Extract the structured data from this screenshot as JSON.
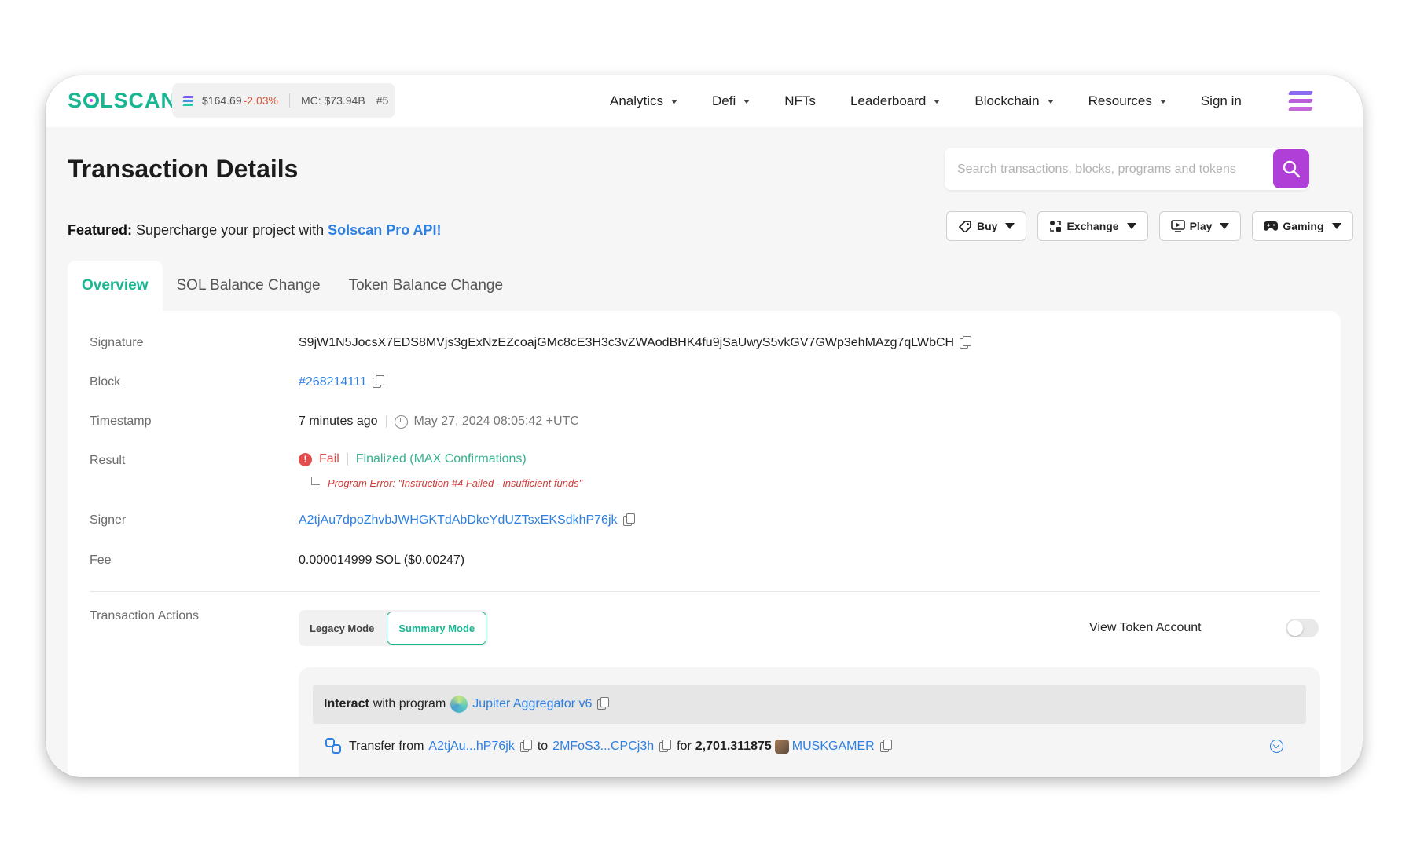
{
  "header": {
    "logo_text": "SOLSCAN",
    "sol_price": "$164.69",
    "sol_change": "-2.03%",
    "market_cap": "MC: $73.94B",
    "rank": "#5",
    "nav": [
      {
        "label": "Analytics"
      },
      {
        "label": "Defi"
      },
      {
        "label": "NFTs"
      },
      {
        "label": "Leaderboard"
      },
      {
        "label": "Blockchain"
      },
      {
        "label": "Resources"
      },
      {
        "label": "Sign in"
      }
    ]
  },
  "page": {
    "title": "Transaction Details",
    "search_placeholder": "Search transactions, blocks, programs and tokens"
  },
  "featured": {
    "prefix": "Featured:",
    "text": "Supercharge your project with",
    "link": "Solscan Pro API!"
  },
  "action_buttons": [
    {
      "label": "Buy"
    },
    {
      "label": "Exchange"
    },
    {
      "label": "Play"
    },
    {
      "label": "Gaming"
    }
  ],
  "tabs": [
    {
      "label": "Overview",
      "active": true
    },
    {
      "label": "SOL Balance Change"
    },
    {
      "label": "Token Balance Change"
    }
  ],
  "details": {
    "signature_label": "Signature",
    "signature": "S9jW1N5JocsX7EDS8MVjs3gExNzEZcoajGMc8cE3H3c3vZWAodBHK4fu9jSaUwyS5vkGV7GWp3ehMAzg7qLWbCH",
    "block_label": "Block",
    "block": "#268214111",
    "timestamp_label": "Timestamp",
    "timestamp_relative": "7 minutes ago",
    "timestamp_abs": "May 27, 2024 08:05:42 +UTC",
    "result_label": "Result",
    "result_status": "Fail",
    "result_finality": "Finalized (MAX Confirmations)",
    "program_error": "Program Error: \"Instruction #4 Failed - insufficient funds\"",
    "signer_label": "Signer",
    "signer": "A2tjAu7dpoZhvbJWHGKTdAbDkeYdUZTsxEKSdkhP76jk",
    "fee_label": "Fee",
    "fee": "0.000014999 SOL ($0.00247)",
    "actions_label": "Transaction Actions",
    "mode_legacy": "Legacy Mode",
    "mode_summary": "Summary Mode",
    "view_token_account": "View Token Account"
  },
  "actions": {
    "interact_bold": "Interact",
    "interact_text": "with program",
    "program_name": "Jupiter Aggregator v6",
    "transfer_text": "Transfer from",
    "from": "A2tjAu...hP76jk",
    "to_text": "to",
    "to": "2MFoS3...CPCj3h",
    "for_text": "for",
    "amount": "2,701.311875",
    "token": "MUSKGAMER"
  },
  "colors": {
    "brand_green": "#19b692",
    "accent_purple": "#b03fd8",
    "link_blue": "#2d7fe0",
    "fail_red": "#e44d4d"
  }
}
